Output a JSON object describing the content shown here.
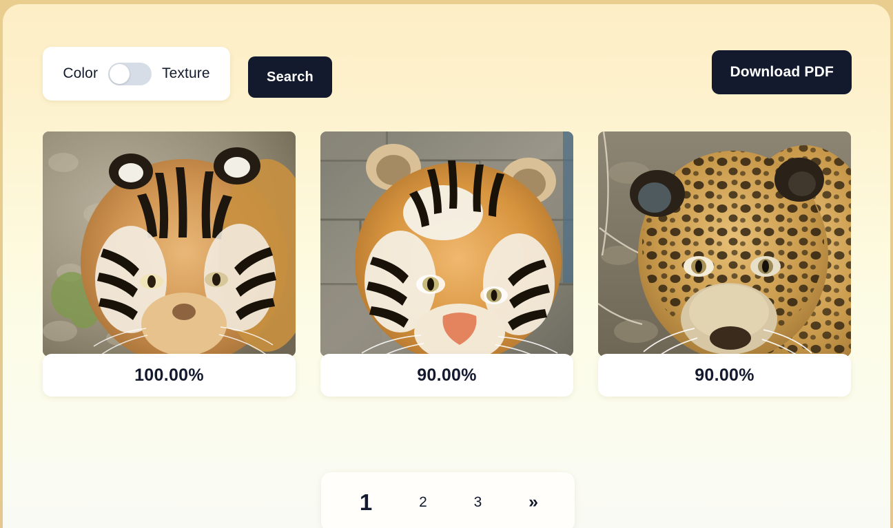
{
  "theme": {
    "frame_color": "#e6cb8d",
    "page_gradient_top": "#fdeec6",
    "page_gradient_bottom": "#f9faf4",
    "accent_dark": "#131a2e",
    "card_background": "#ffffff",
    "toggle_track": "#d7dde7",
    "toggle_knob": "#ffffff"
  },
  "toolbar": {
    "mode_left_label": "Color",
    "mode_right_label": "Texture",
    "toggle_state": "off",
    "search_label": "Search",
    "download_label": "Download PDF"
  },
  "results": [
    {
      "score": "100.00%",
      "image_name": "tiger-closeup-on-gravel",
      "image_alt": "Close-up of a tiger facing the camera on rocky ground"
    },
    {
      "score": "90.00%",
      "image_name": "tiger-closeup-on-rocks",
      "image_alt": "Close-up of a tiger's face in front of a rock wall"
    },
    {
      "score": "90.00%",
      "image_name": "jaguar-closeup-on-ground",
      "image_alt": "Close-up of a spotted jaguar walking toward the camera"
    }
  ],
  "pagination": {
    "current_page": "1",
    "page_2": "2",
    "page_3": "3",
    "next_label": "»"
  }
}
